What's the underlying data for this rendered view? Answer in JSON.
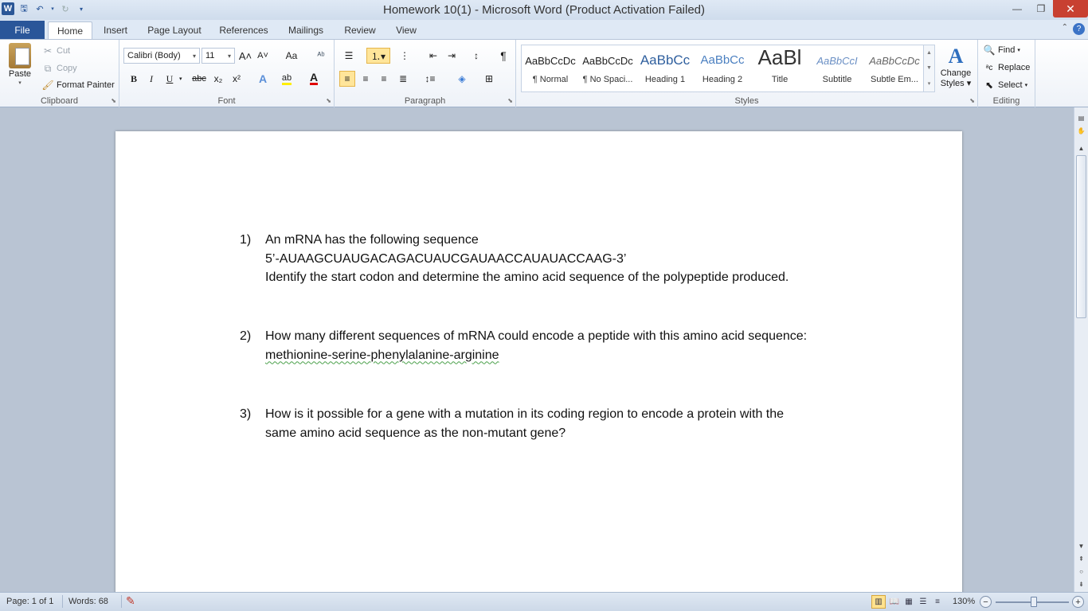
{
  "window": {
    "title": "Homework 10(1)  -  Microsoft Word (Product Activation Failed)",
    "minimize": "—",
    "restore": "❐",
    "close": "✕"
  },
  "tabs": {
    "file": "File",
    "items": [
      "Home",
      "Insert",
      "Page Layout",
      "References",
      "Mailings",
      "Review",
      "View"
    ],
    "active": "Home"
  },
  "clipboard": {
    "paste": "Paste",
    "cut": "Cut",
    "copy": "Copy",
    "format_painter": "Format Painter",
    "label": "Clipboard"
  },
  "font": {
    "name": "Calibri (Body)",
    "size": "11",
    "label": "Font",
    "bold": "B",
    "italic": "I",
    "underline": "U",
    "strike": "abc",
    "subscript": "x₂",
    "superscript": "x²",
    "grow": "A˄",
    "shrink": "A˅",
    "case": "Aa"
  },
  "paragraph": {
    "label": "Paragraph",
    "pilcrow": "¶"
  },
  "styles": {
    "label": "Styles",
    "items": [
      {
        "sample": "AaBbCcDc",
        "name": "¶ Normal"
      },
      {
        "sample": "AaBbCcDc",
        "name": "¶ No Spaci..."
      },
      {
        "sample": "AaBbCc",
        "name": "Heading 1"
      },
      {
        "sample": "AaBbCc",
        "name": "Heading 2"
      },
      {
        "sample": "AaBl",
        "name": "Title"
      },
      {
        "sample": "AaBbCcI",
        "name": "Subtitle"
      },
      {
        "sample": "AaBbCcDc",
        "name": "Subtle Em..."
      }
    ],
    "change_styles_1": "Change",
    "change_styles_2": "Styles ▾"
  },
  "editing": {
    "label": "Editing",
    "find": "Find",
    "replace": "Replace",
    "select": "Select"
  },
  "document": {
    "questions": [
      {
        "num": "1)",
        "lines": [
          "An mRNA has the following sequence",
          "5’-AUAAGCUAUGACAGACUAUCGAUAACCAUAUACCAAG-3’",
          "Identify the start codon and determine the amino acid sequence of the polypeptide produced."
        ]
      },
      {
        "num": "2)",
        "lines": [
          "How many different sequences of mRNA could encode a peptide with this amino acid sequence:",
          "methionine-serine-phenylalanine-arginine"
        ]
      },
      {
        "num": "3)",
        "lines": [
          "How is it possible for a gene with a mutation in its coding region to encode a protein with the",
          "same amino acid sequence as the non-mutant gene?"
        ]
      }
    ]
  },
  "status": {
    "page": "Page: 1 of 1",
    "words": "Words: 68",
    "zoom": "130%"
  }
}
